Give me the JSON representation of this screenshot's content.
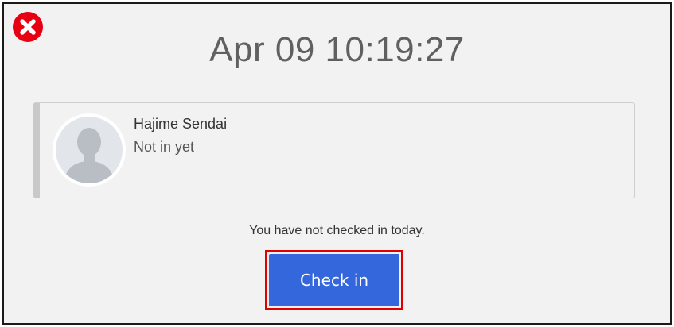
{
  "dialog": {
    "close_icon": "close-icon",
    "datetime": "Apr 09 10:19:27"
  },
  "user_card": {
    "avatar_icon": "user-avatar-icon",
    "name": "Hajime Sendai",
    "status": "Not in yet"
  },
  "notice": "You have not checked in today.",
  "checkin_button": {
    "label": "Check in",
    "color": "#3567dc"
  },
  "colors": {
    "close_red": "#e60012",
    "highlight_border": "#e00000",
    "background": "#f2f2f2"
  }
}
